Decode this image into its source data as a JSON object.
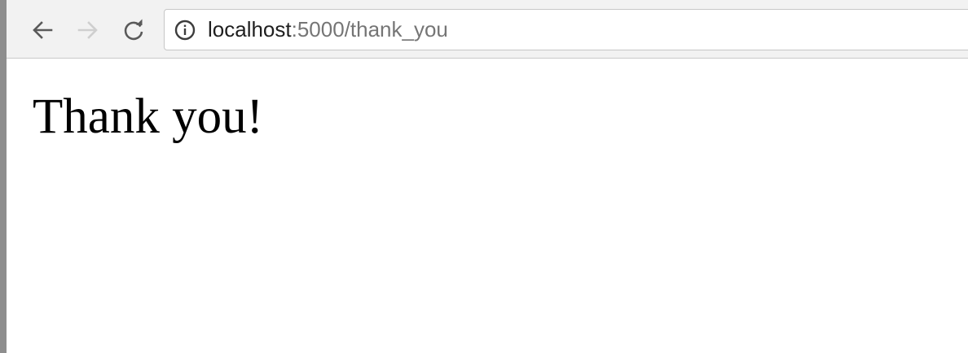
{
  "browser": {
    "address_bar": {
      "host": "localhost",
      "path": ":5000/thank_you"
    },
    "icons": {
      "back": "arrow-left-icon",
      "forward": "arrow-right-icon",
      "reload": "reload-icon",
      "site_info": "info-icon"
    }
  },
  "page": {
    "heading": "Thank you!"
  }
}
